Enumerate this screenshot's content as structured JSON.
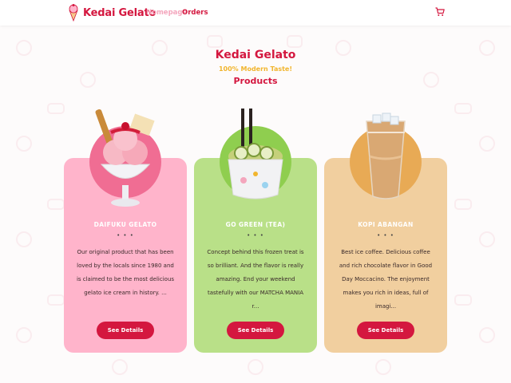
{
  "navbar": {
    "brand_name": "Kedai Gelato",
    "links": [
      {
        "label": "Homepage"
      },
      {
        "label": "Orders"
      }
    ]
  },
  "hero": {
    "title": "Kedai Gelato",
    "tagline": "100% Modern Taste!",
    "subtitle": "Products"
  },
  "products": [
    {
      "name": "DAIFUKU GELATO",
      "dots": "• • •",
      "description": "Our original product that has been loved by the locals since 1980 and is claimed to be the most delicious gelato ice cream in history. ...",
      "button_label": "See Details"
    },
    {
      "name": "GO GREEN (TEA)",
      "dots": "• • •",
      "description": "Concept behind this frozen treat is so brilliant. And the flavor is really amazing. End your weekend tastefully with our MATCHA MANIA r...",
      "button_label": "See Details"
    },
    {
      "name": "KOPI ABANGAN",
      "dots": "• • •",
      "description": "Best ice coffee. Delicious coffee and rich chocolate flavor in Good Day Moccacino. The enjoyment makes you rich in ideas, full of imagi...",
      "button_label": "See Details"
    }
  ],
  "colors": {
    "accent": "#d4173f",
    "tagline": "#f1b52e",
    "card_pink": "#ffb4cb",
    "card_green": "#b9e088",
    "card_tan": "#f1cf9f"
  },
  "icons": [
    "gelato-logo-icon",
    "cart-icon"
  ]
}
